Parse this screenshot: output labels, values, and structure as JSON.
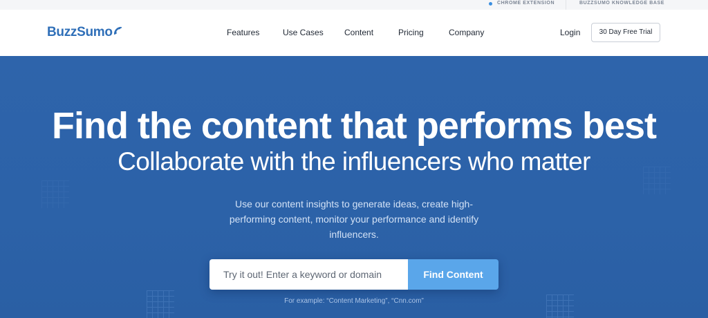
{
  "topbar": {
    "chrome_extension": "Chrome Extension",
    "knowledge_base": "BuzzSumo Knowledge Base"
  },
  "header": {
    "logo_text": "BuzzSumo",
    "nav": [
      "Features",
      "Use Cases",
      "Content",
      "Pricing",
      "Company"
    ],
    "login": "Login",
    "trial_button": "30 Day Free Trial"
  },
  "hero": {
    "headline": "Find the content that performs best",
    "subheadline": "Collaborate with the influencers who matter",
    "description": "Use our content insights to generate ideas, create high-performing content, monitor your performance and identify influencers.",
    "search_placeholder": "Try it out! Enter a keyword or domain",
    "search_value": "",
    "search_button": "Find Content",
    "example": "For example: “Content Marketing”, “Cnn.com”"
  },
  "colors": {
    "hero_background": "#2e64ab",
    "accent_button": "#5aa6ea",
    "logo": "#2f6fb8"
  },
  "icons": [
    "wifi-signal-icon",
    "status-dot-icon"
  ]
}
